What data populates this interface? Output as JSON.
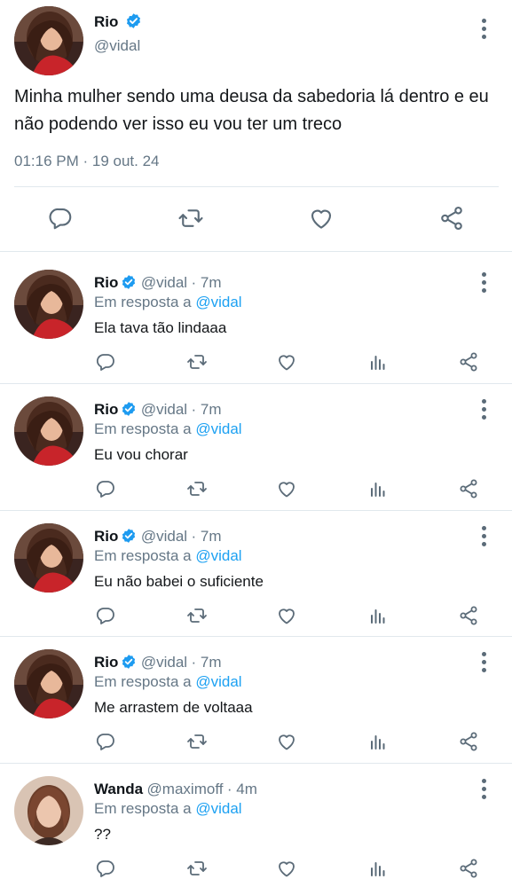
{
  "main_tweet": {
    "name": "Rio",
    "handle": "@vidal",
    "text": "Minha mulher sendo uma deusa da sabedoria lá dentro e eu não podendo ver isso eu vou ter um treco",
    "timestamp": "01:16 PM · 19 out. 24",
    "actions": [
      "reply-icon",
      "retweet-icon",
      "like-icon",
      "share-icon"
    ]
  },
  "replies": [
    {
      "name": "Rio",
      "handle": "@vidal",
      "time": "· 7m",
      "reply_prefix": "Em resposta a",
      "reply_to": "@vidal",
      "text": "Ela tava tão lindaaa"
    },
    {
      "name": "Rio",
      "handle": "@vidal",
      "time": "· 7m",
      "reply_prefix": "Em resposta a",
      "reply_to": "@vidal",
      "text": "Eu vou chorar"
    },
    {
      "name": "Rio",
      "handle": "@vidal",
      "time": "· 7m",
      "reply_prefix": "Em resposta a",
      "reply_to": "@vidal",
      "text": "Eu não babei o suficiente"
    },
    {
      "name": "Rio",
      "handle": "@vidal",
      "time": "· 7m",
      "reply_prefix": "Em resposta a",
      "reply_to": "@vidal",
      "text": "Me arrastem de voltaaa"
    },
    {
      "name": "Wanda",
      "handle": "@maximoff",
      "time": "· 4m",
      "reply_prefix": "Em resposta a",
      "reply_to": "@vidal",
      "text": "??"
    }
  ],
  "colors": {
    "accent": "#1da1f2",
    "verified": "#1d9bf0",
    "icon": "#5b6b78",
    "muted": "#657786"
  }
}
